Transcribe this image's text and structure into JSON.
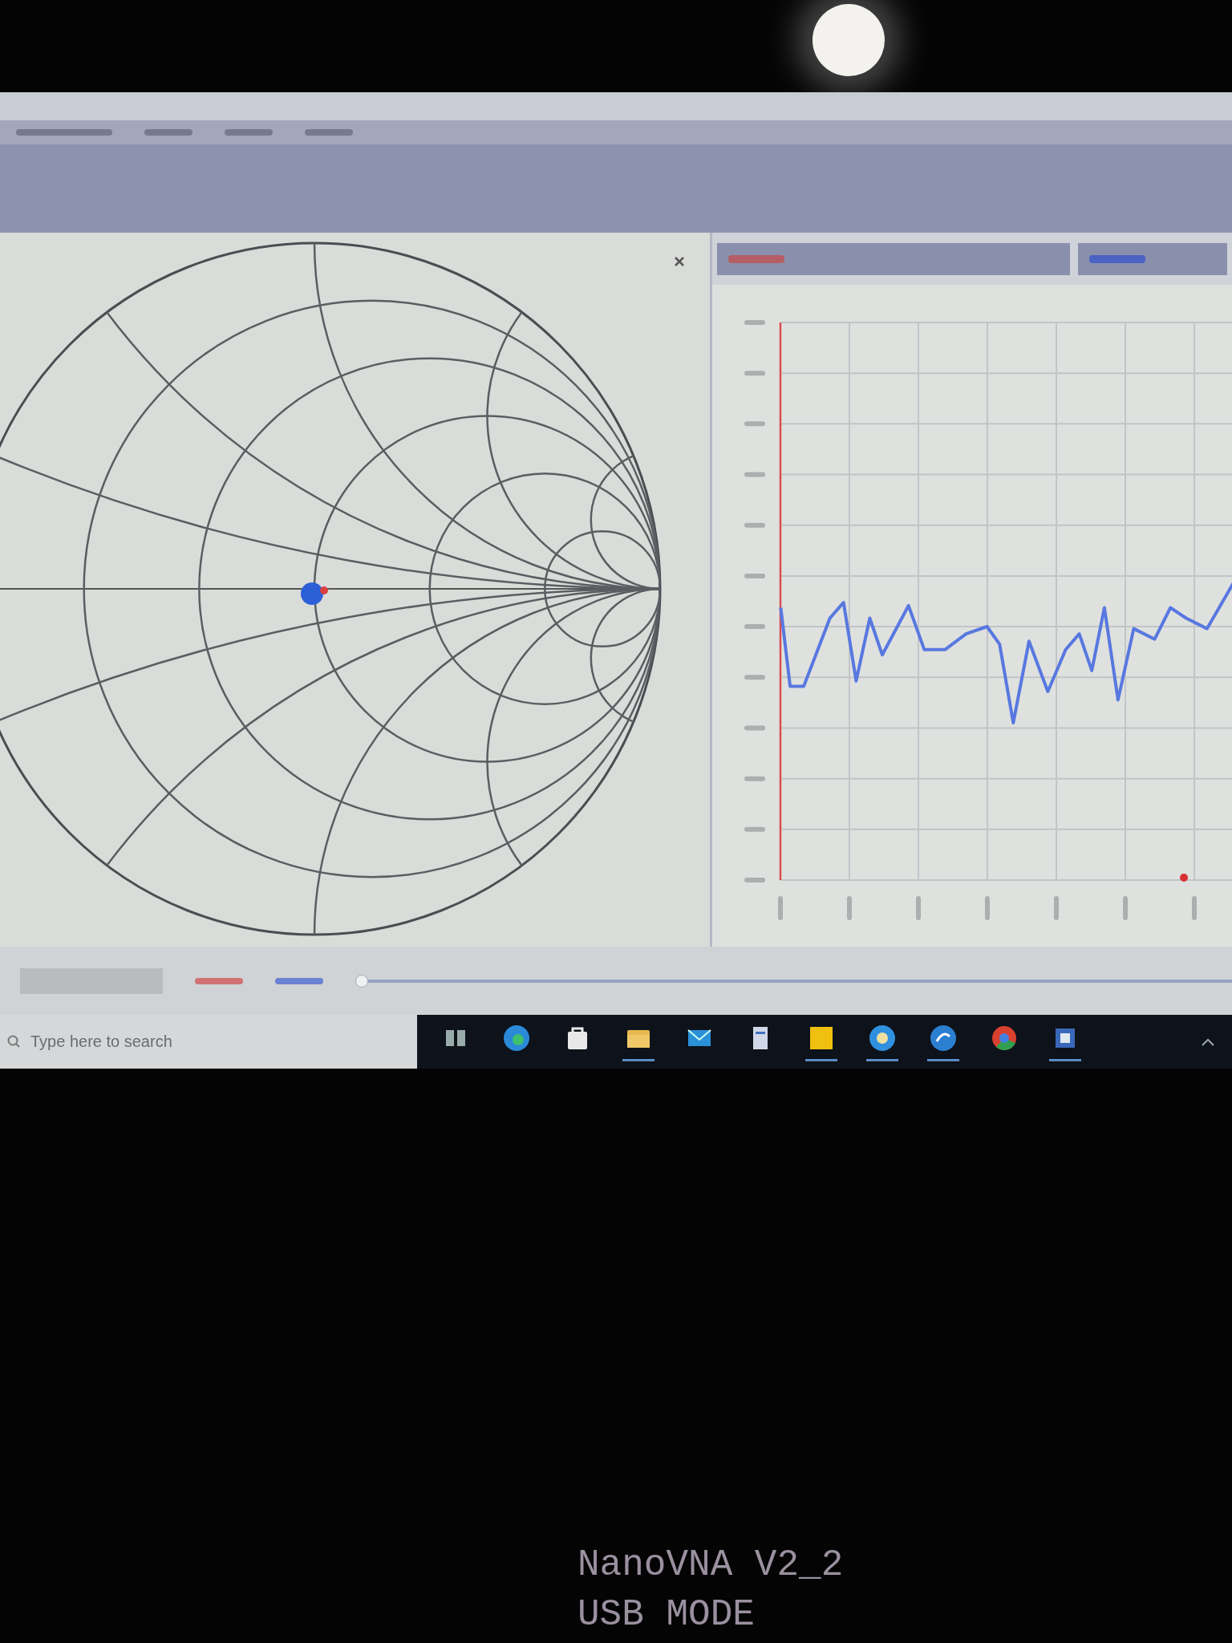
{
  "slider": {
    "level": 0
  },
  "search": {
    "placeholder": "Type here to search"
  },
  "device_screen": {
    "lines": [
      "NanoVNA V2_2",
      "USB MODE"
    ]
  }
}
